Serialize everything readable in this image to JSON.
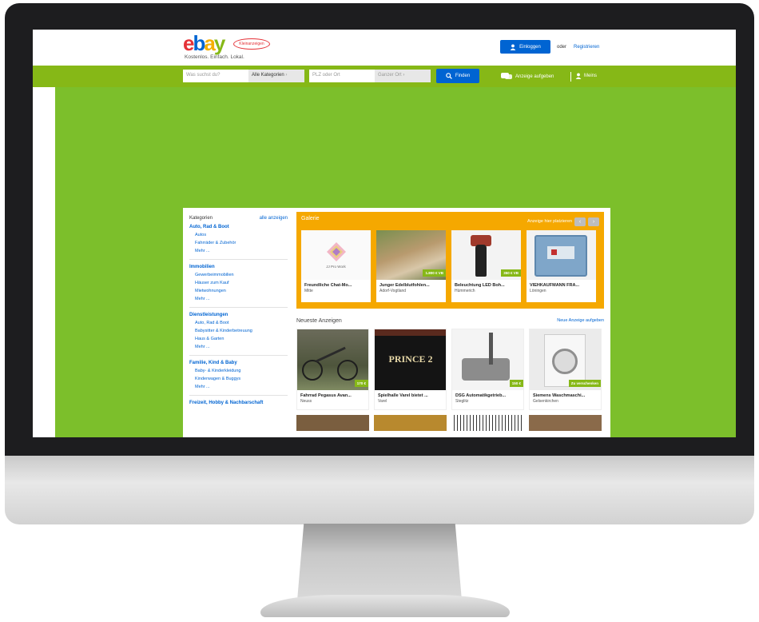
{
  "header": {
    "logo_letters": [
      "e",
      "b",
      "a",
      "y"
    ],
    "logo_badge": "Kleinanzeigen",
    "tagline": "Kostenlos. Einfach. Lokal.",
    "login_label": "Einloggen",
    "or_text": "oder",
    "register_label": "Registrieren"
  },
  "search": {
    "what_placeholder": "Was suchst du?",
    "category_value": "Alle Kategorien",
    "plz_placeholder": "PLZ oder Ort",
    "radius_value": "Ganzer Ort",
    "find_label": "Finden",
    "post_ad_label": "Anzeige aufgeben",
    "mine_label": "Meins"
  },
  "sidebar": {
    "title": "Kategorien",
    "show_all": "alle anzeigen",
    "groups": [
      {
        "title": "Auto, Rad & Boot",
        "items": [
          "Autos",
          "Fahrräder & Zubehör",
          "Mehr ..."
        ]
      },
      {
        "title": "Immobilien",
        "items": [
          "Gewerbeimmobilien",
          "Häuser zum Kauf",
          "Mietwohnungen",
          "Mehr ..."
        ]
      },
      {
        "title": "Dienstleistungen",
        "items": [
          "Auto, Rad & Boot",
          "Babysitter & Kinderbetreuung",
          "Haus & Garten",
          "Mehr ..."
        ]
      },
      {
        "title": "Familie, Kind & Baby",
        "items": [
          "Baby- & Kinderkleidung",
          "Kinderwagen & Buggys",
          "Mehr ..."
        ]
      },
      {
        "title": "Freizeit, Hobby & Nachbarschaft",
        "items": []
      }
    ]
  },
  "gallery": {
    "title": "Galerie",
    "place_here": "Anzeige hier platzieren",
    "items": [
      {
        "title": "Freundliche Chat-Mo...",
        "location": "Mitte",
        "price": ""
      },
      {
        "title": "Junger Edelblutfohlen...",
        "location": "Adorf-Vogtland",
        "price": "1.800 € VB"
      },
      {
        "title": "Beleuchtung LED Boh...",
        "location": "Hümmerich",
        "price": "350 € VB"
      },
      {
        "title": "VIEHKAUFMANN FRA...",
        "location": "Löningen",
        "price": ""
      }
    ],
    "brand_caption": "JJ Pro Work"
  },
  "newest": {
    "title": "Neueste Anzeigen",
    "post_link": "Neue Anzeige aufgeben",
    "items": [
      {
        "title": "Fahrrad Pegasus Avan...",
        "location": "Neuss",
        "price": "170 €"
      },
      {
        "title": "Spielhalle Varel bietet ...",
        "location": "Varel",
        "price": "",
        "overlay_text": "PRINCE 2"
      },
      {
        "title": "DSG Automatikgetrieb...",
        "location": "Steglitz",
        "price": "150 €"
      },
      {
        "title": "Siemens Waschmaschi...",
        "location": "Gelsenkirchen",
        "price": "Zu verschenken"
      }
    ]
  },
  "colors": {
    "ebay_green": "#86b817",
    "ebay_blue": "#0064d2",
    "gallery_orange": "#f5a800"
  }
}
